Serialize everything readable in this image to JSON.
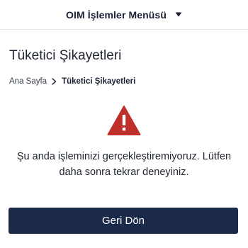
{
  "header": {
    "menu_title": "OIM İşlemler Menüsü",
    "menu_icon": "caret-down-icon"
  },
  "main": {
    "page_title": "Tüketici Şikayetleri",
    "breadcrumb": {
      "home": "Ana Sayfa",
      "separator_icon": "chevron-right-icon",
      "current": "Tüketici Şikayetleri"
    },
    "alert_icon": "warning-triangle-icon",
    "alert_color": "#c0302a",
    "message": "Şu anda işleminizi gerçekleştiremiyoruz. Lütfen daha sonra tekrar deneyiniz.",
    "back_button_label": "Geri Dön",
    "back_button_color": "#1c2a4a"
  }
}
